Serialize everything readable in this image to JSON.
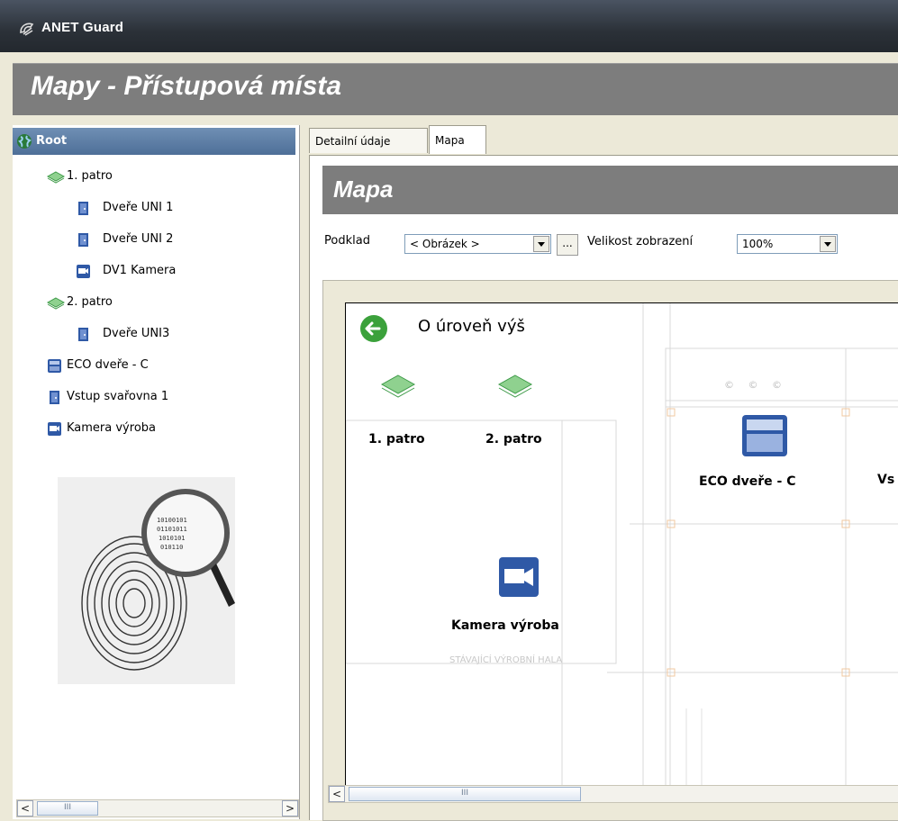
{
  "window": {
    "title": "ANET Guard"
  },
  "header": {
    "title": "Mapy - Přístupová místa"
  },
  "tree": {
    "root_label": "Root",
    "items": [
      {
        "label": "1. patro",
        "icon": "floor-icon"
      },
      {
        "label": "Dveře UNI 1",
        "icon": "door-icon"
      },
      {
        "label": "Dveře UNI 2",
        "icon": "door-icon"
      },
      {
        "label": "DV1 Kamera",
        "icon": "camera-icon"
      },
      {
        "label": "2. patro",
        "icon": "floor-icon"
      },
      {
        "label": "Dveře UNI3",
        "icon": "door-icon"
      },
      {
        "label": "ECO dveře - C",
        "icon": "controller-icon"
      },
      {
        "label": "Vstup svařovna 1",
        "icon": "door-icon"
      },
      {
        "label": "Kamera výroba",
        "icon": "camera-icon"
      }
    ]
  },
  "tabs": {
    "details": "Detailní údaje",
    "map": "Mapa"
  },
  "map_panel": {
    "title": "Mapa",
    "background_label": "Podklad",
    "background_value": "< Obrázek >",
    "browse_label": "...",
    "zoom_label": "Velikost zobrazení",
    "zoom_value": "100%"
  },
  "map": {
    "up_label": "O úroveň výš",
    "floor1": "1. patro",
    "floor2": "2. patro",
    "eco": "ECO dveře - C",
    "vstup_partial": "Vs",
    "camera": "Kamera výroba",
    "plan_text": "STÁVAJÍCÍ VÝROBNÍ HALA",
    "plan_marks": "© © ©"
  },
  "scrollbars": {
    "grip": "III"
  },
  "colors": {
    "title_bar": "#2b3138",
    "header_bg": "#7d7d7d",
    "selection": "#5a7aa3",
    "floor_icon": "#6bbf6e",
    "device_icon": "#2f59a6"
  }
}
